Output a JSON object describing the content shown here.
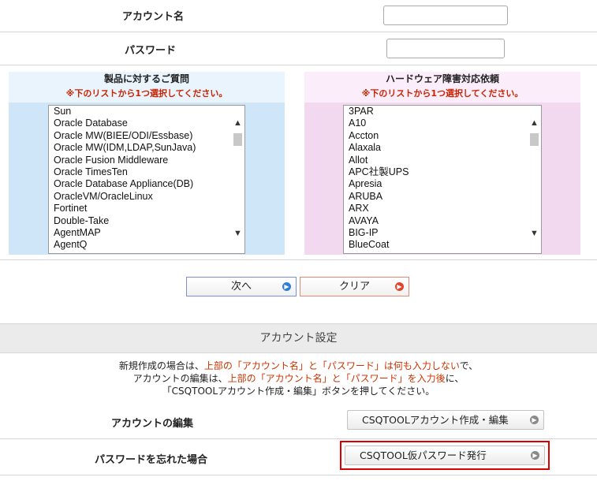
{
  "account": {
    "label": "アカウント名",
    "value": ""
  },
  "password": {
    "label": "パスワード",
    "value": ""
  },
  "product_panel": {
    "title": "製品に対するご質問",
    "note": "※下のリストから1つ選択してください。",
    "options": [
      "Sun",
      "Oracle Database",
      "Oracle MW(BIEE/ODI/Essbase)",
      "Oracle MW(IDM,LDAP,SunJava)",
      "Oracle Fusion Middleware",
      "Oracle TimesTen",
      "Oracle Database Appliance(DB)",
      "OracleVM/OracleLinux",
      "Fortinet",
      "Double-Take",
      "AgentMAP",
      "AgentQ"
    ]
  },
  "hardware_panel": {
    "title": "ハードウェア障害対応依頼",
    "note": "※下のリストから1つ選択してください。",
    "options": [
      "3PAR",
      "A10",
      "Accton",
      "Alaxala",
      "Allot",
      "APC社製UPS",
      "Apresia",
      "ARUBA",
      "ARX",
      "AVAYA",
      "BIG-IP",
      "BlueCoat"
    ]
  },
  "buttons": {
    "next": "次へ",
    "clear": "クリア"
  },
  "account_settings": {
    "title": "アカウント設定",
    "desc_line1_a": "新規作成の場合は、",
    "desc_line1_b": "上部の「アカウント名」と「パスワード」は何も入力しない",
    "desc_line1_c": "で、",
    "desc_line2_a": "アカウントの編集は、",
    "desc_line2_b": "上部の「アカウント名」と「パスワード」を入力後",
    "desc_line2_c": "に、",
    "desc_line3": "「CSQTOOLアカウント作成・編集」ボタンを押してください。",
    "edit_label": "アカウントの編集",
    "edit_button": "CSQTOOLアカウント作成・編集",
    "forgot_label": "パスワードを忘れた場合",
    "forgot_button": "CSQTOOL仮パスワード発行"
  },
  "colors": {
    "product_panel_bg": "#cfe6f8",
    "product_header_bg": "#e9f4fd",
    "hardware_panel_bg": "#f2d9f0",
    "hardware_header_bg": "#fbeefa",
    "note_red": "#cc2200",
    "highlight_red": "#dd0000",
    "next_icon": "#2a7fd8",
    "clear_icon": "#e0442a"
  },
  "icons": {
    "scroll_up": "chevron-up-icon",
    "scroll_down": "chevron-down-icon",
    "button_arrow": "arrow-right-circle-icon"
  }
}
